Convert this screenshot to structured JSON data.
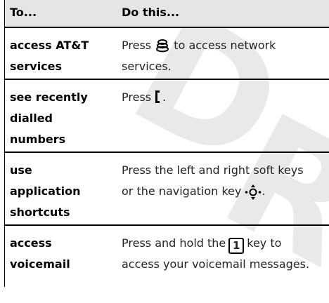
{
  "watermark": "DRAFT",
  "table": {
    "header": {
      "col1": "To...",
      "col2": "Do this..."
    },
    "rows": [
      {
        "action": [
          "access AT&T",
          "services"
        ],
        "desc": [
          "Press",
          "to access network",
          "services."
        ],
        "icon": "network-services-icon"
      },
      {
        "action": [
          "see recently",
          "dialled",
          "numbers"
        ],
        "desc": [
          "Press",
          "."
        ],
        "icon": "left-soft-key-icon"
      },
      {
        "action": [
          "use",
          "application",
          "shortcuts"
        ],
        "desc": [
          "Press the left and right soft keys",
          "or the navigation key",
          "."
        ],
        "icon": "navigation-key-icon"
      },
      {
        "action": [
          "access",
          "voicemail"
        ],
        "desc": [
          "Press and hold the",
          "1",
          "key to",
          "access your voicemail messages."
        ],
        "icon": "key-1-icon"
      }
    ]
  }
}
